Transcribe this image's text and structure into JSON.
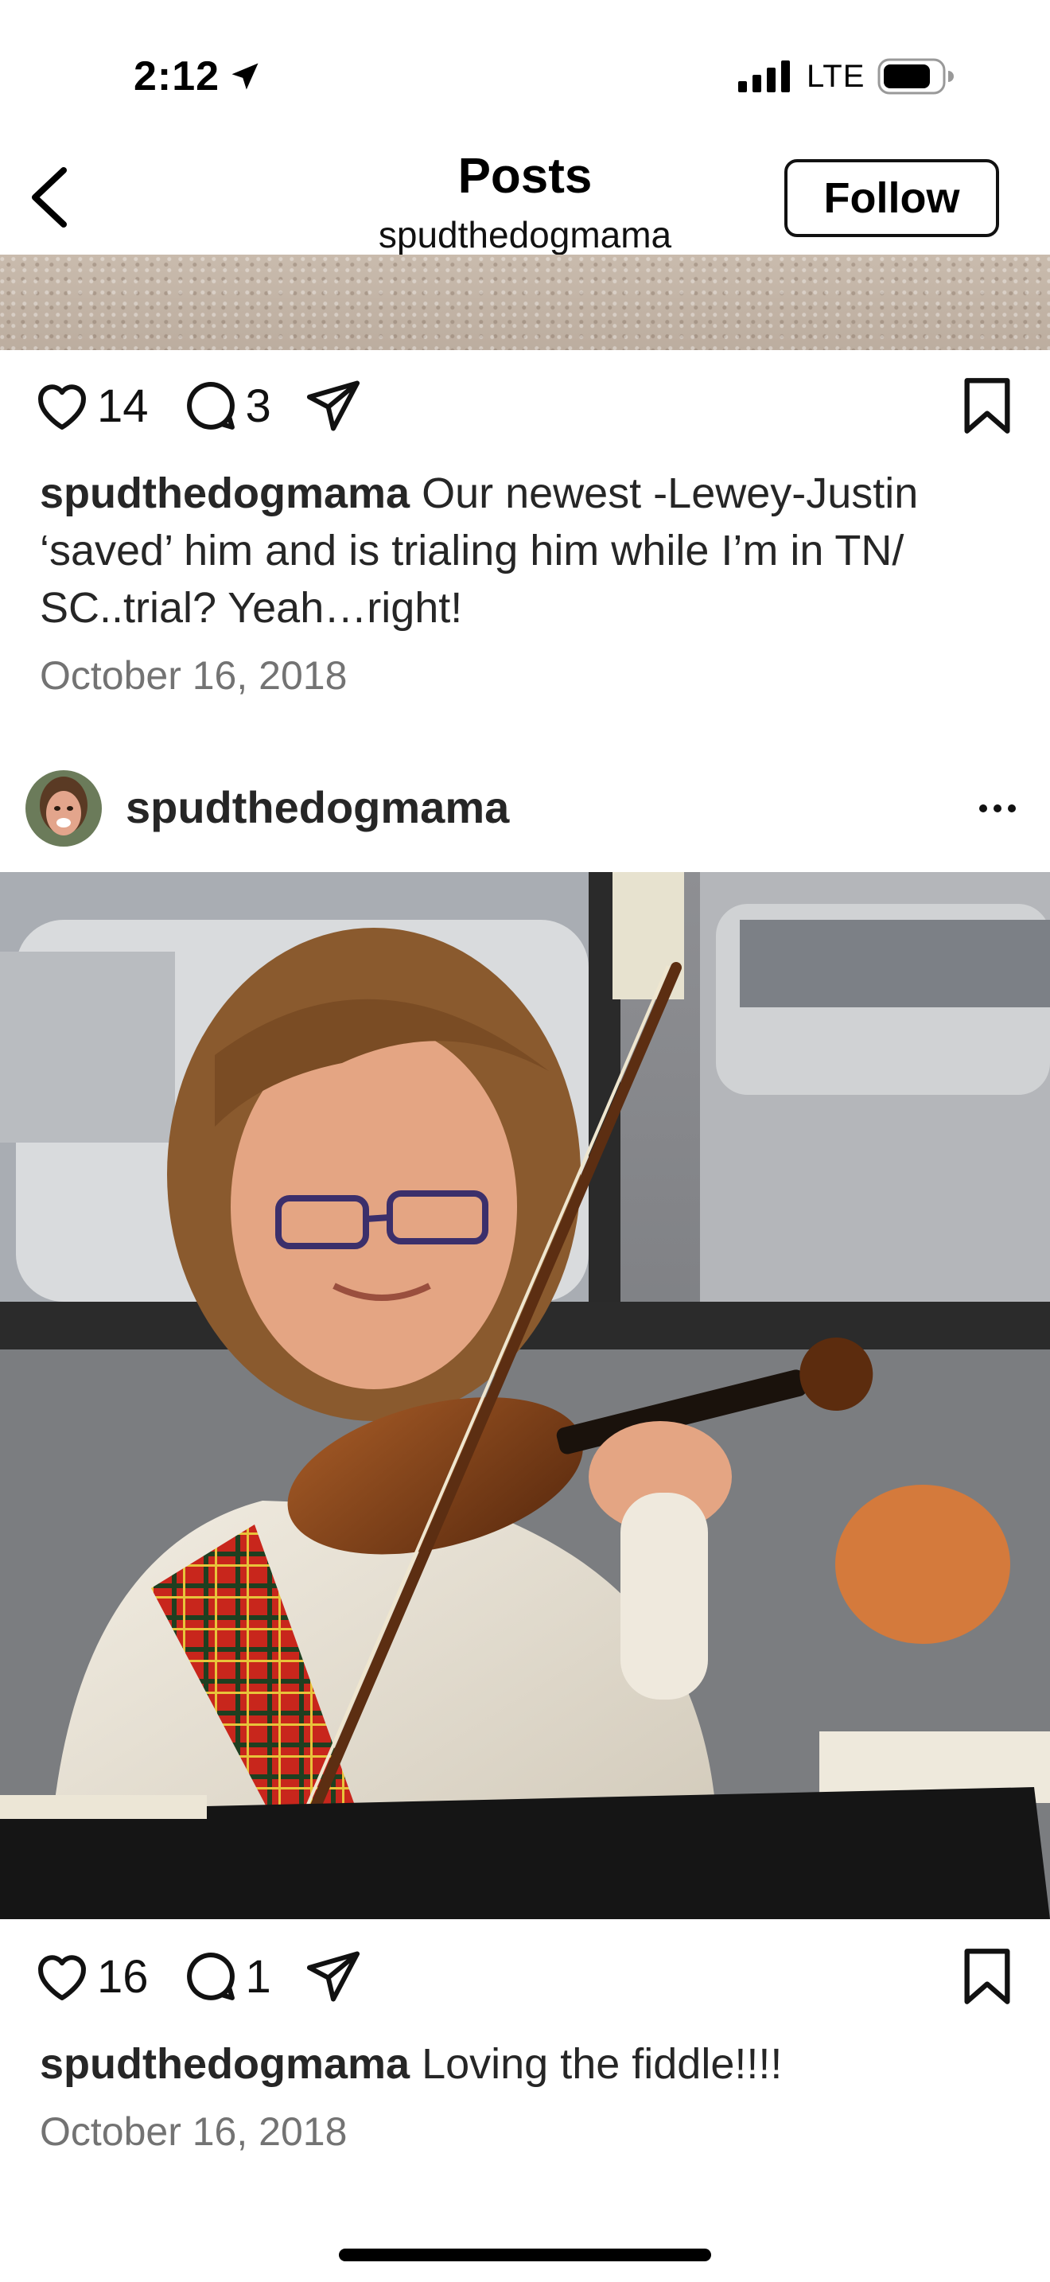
{
  "status_bar": {
    "time": "2:12",
    "network": "LTE"
  },
  "header": {
    "title": "Posts",
    "subtitle": "spudthedogmama",
    "follow_label": "Follow"
  },
  "post1": {
    "likes": "14",
    "comments": "3",
    "username": "spudthedogmama",
    "caption": "Our newest -Lewey-Justin ‘saved’ him and  is trialing him while I’m in TN/ SC..trial? Yeah…right!",
    "date": "October 16, 2018"
  },
  "post2": {
    "username": "spudthedogmama",
    "likes": "16",
    "comments": "1",
    "caption": "Loving the fiddle!!!!",
    "date": "October 16, 2018"
  }
}
